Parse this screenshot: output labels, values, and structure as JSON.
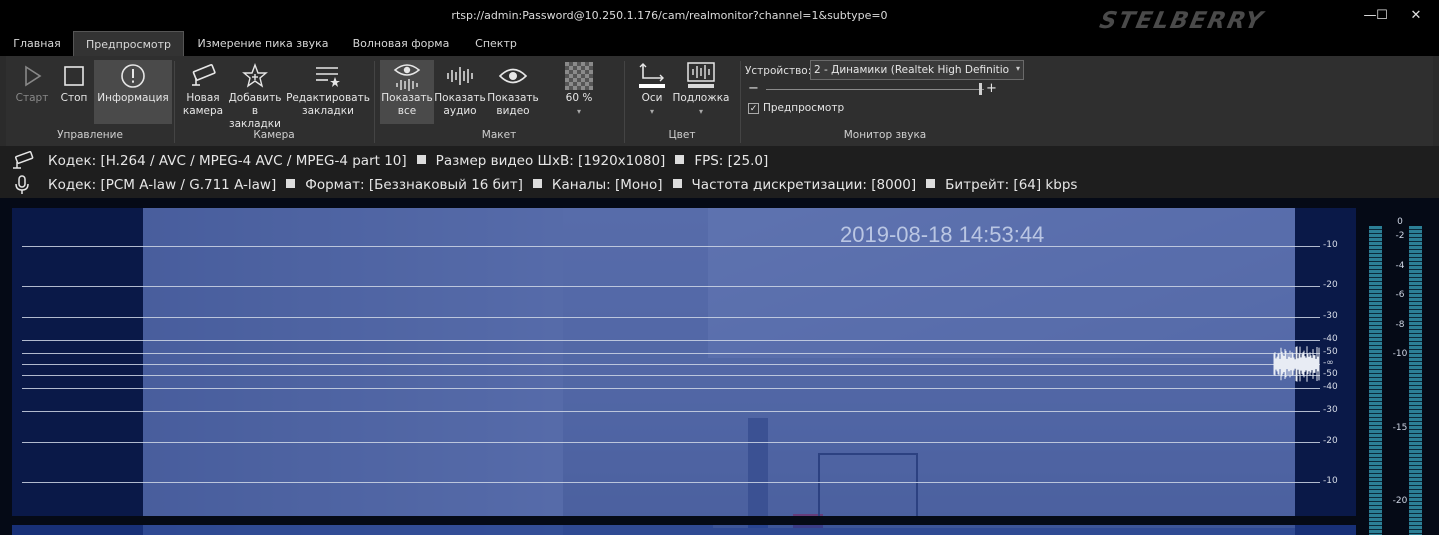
{
  "window": {
    "title": "rtsp://admin:Password@10.250.1.176/cam/realmonitor?channel=1&subtype=0",
    "brand": "STELBERRY",
    "min_glyph": "—",
    "max_glyph": "☐",
    "close_glyph": "✕"
  },
  "tabs": [
    "Главная",
    "Предпросмотр",
    "Измерение пика звука",
    "Волновая форма",
    "Спектр"
  ],
  "ribbon": {
    "control": {
      "label": "Управление",
      "start": "Старт",
      "stop": "Стоп",
      "info": "Информация"
    },
    "camera": {
      "label": "Камера",
      "new_l1": "Новая",
      "new_l2": "камера",
      "add_l1": "Добавить",
      "add_l2": "в закладки",
      "edit_l1": "Редактировать",
      "edit_l2": "закладки"
    },
    "layout": {
      "label": "Макет",
      "all_l1": "Показать",
      "all_l2": "все",
      "audio_l1": "Показать",
      "audio_l2": "аудио",
      "video_l1": "Показать",
      "video_l2": "видео",
      "zoom": "60 %"
    },
    "color": {
      "label": "Цвет",
      "axes": "Оси",
      "background": "Подложка"
    },
    "sound": {
      "label": "Монитор звука",
      "device_label": "Устройство:",
      "device_value": "2 - Динамики (Realtek High Definition",
      "minus": "−",
      "plus": "+",
      "volume_fraction": 0.98,
      "preview_label": "Предпросмотр",
      "preview_checked": true
    }
  },
  "info": {
    "video_codec": "Кодек: [H.264 / AVC / MPEG-4 AVC / MPEG-4 part 10]",
    "video_size": "Размер видео ШxВ: [1920x1080]",
    "video_fps": "FPS: [25.0]",
    "audio_codec": "Кодек: [PCM A-law / G.711 A-law]",
    "audio_format": "Формат: [Беззнаковый 16 бит]",
    "audio_channels": "Каналы: [Моно]",
    "audio_rate": "Частота дискретизации: [8000]",
    "audio_bitrate": "Битрейт: [64] kbps"
  },
  "video": {
    "timestamp": "2019-08-18 14:53:44",
    "wave_labels": [
      "-10",
      "-20",
      "-30",
      "-40",
      "-50",
      "-∞",
      "-50",
      "-40",
      "-30",
      "-20",
      "-10"
    ],
    "meter_labels": [
      "0",
      "-2",
      "-4",
      "-6",
      "-8",
      "-10",
      "-15",
      "-20"
    ]
  },
  "colors": {
    "window_bg": "#1e1e1e",
    "overlay_blue": "#3250a0",
    "panel_dark": "#0a1a3c"
  }
}
